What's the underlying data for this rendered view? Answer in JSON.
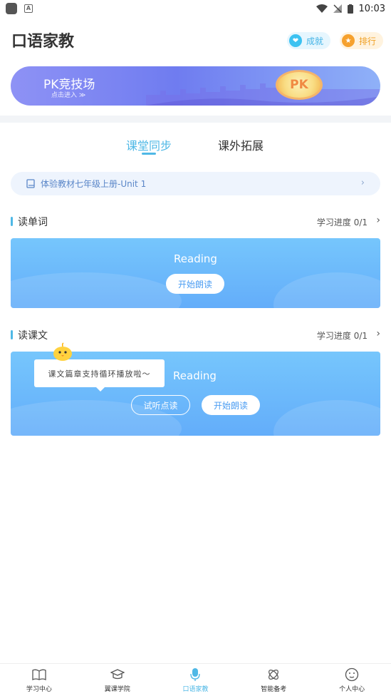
{
  "status_bar": {
    "time": "10:03"
  },
  "header": {
    "title": "口语家教",
    "achievement_label": "成就",
    "ranking_label": "排行"
  },
  "pk_banner": {
    "title": "PK竞技场",
    "subtitle": "点击进入 ≫",
    "badge_text": "PK"
  },
  "tabs": [
    {
      "label": "课堂同步",
      "active": true
    },
    {
      "label": "课外拓展",
      "active": false
    }
  ],
  "textbook": {
    "label": "体验教材七年级上册-Unit 1"
  },
  "sections": [
    {
      "title": "读单词",
      "progress_label": "学习进度",
      "progress": "0/1",
      "card_title": "Reading",
      "start_button": "开始朗读"
    },
    {
      "title": "读课文",
      "progress_label": "学习进度",
      "progress": "0/1",
      "card_title": "Reading",
      "tip": "课文篇章支持循环播放啦～",
      "listen_button": "试听点读",
      "start_button": "开始朗读"
    }
  ],
  "bottom_nav": [
    {
      "label": "学习中心",
      "icon": "book-icon",
      "active": false
    },
    {
      "label": "翼课学院",
      "icon": "graduation-cap-icon",
      "active": false
    },
    {
      "label": "口语家教",
      "icon": "microphone-icon",
      "active": true
    },
    {
      "label": "智能备考",
      "icon": "atom-icon",
      "active": false
    },
    {
      "label": "个人中心",
      "icon": "face-icon",
      "active": false
    }
  ],
  "colors": {
    "accent": "#4fb8e6",
    "card_blue": "#63adfa",
    "pk_purple": "#6f7cf0"
  }
}
